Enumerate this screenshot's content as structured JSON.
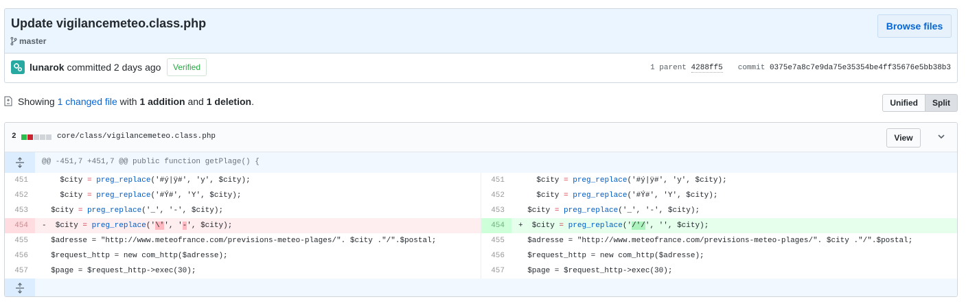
{
  "commit": {
    "title": "Update vigilancemeteo.class.php",
    "branch": "master",
    "browse_label": "Browse files",
    "author": "lunarok",
    "action": "committed 2 days ago",
    "verified": "Verified",
    "parent_label": "1 parent",
    "parent_sha": "4288ff5",
    "commit_label": "commit",
    "commit_sha": "0375e7a8c7e9da75e35354be4ff35676e5bb38b3"
  },
  "toc": {
    "showing": "Showing",
    "changed": "1 changed file",
    "with": "with",
    "additions": "1 addition",
    "and": "and",
    "deletions": "1 deletion",
    "period": ".",
    "unified": "Unified",
    "split": "Split"
  },
  "file": {
    "changes": "2",
    "path": "core/class/vigilancemeteo.class.php",
    "view_label": "View",
    "hunk": "@@ -451,7 +451,7 @@ public function getPlage() {"
  },
  "colors": {
    "accent": "#0366d6",
    "add": "#28a745",
    "del": "#cb2431"
  },
  "icons": [
    "branch-icon",
    "expand-icon",
    "chevron-down-icon",
    "file-diff-icon",
    "avatar-icon"
  ]
}
